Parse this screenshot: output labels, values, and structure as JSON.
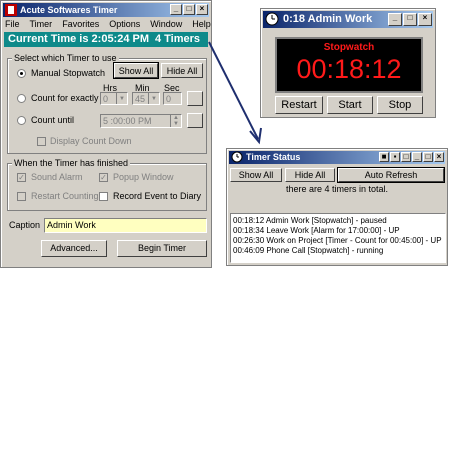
{
  "main": {
    "title": "Acute Softwares Timer",
    "menu": [
      "File",
      "Timer",
      "Favorites",
      "Options",
      "Window",
      "Help"
    ],
    "status_time": "Current Time is 2:05:24 PM",
    "status_count": "4 Timers",
    "select_group_label": "Select which Timer to use",
    "show_all": "Show All",
    "hide_all": "Hide All",
    "manual_stopwatch": "Manual Stopwatch",
    "count_for_exactly": "Count for exactly",
    "hrs_label": "Hrs",
    "min_label": "Min",
    "sec_label": "Sec",
    "hrs_value": "0",
    "min_value": "45",
    "sec_value": "0",
    "count_until": "Count until",
    "until_value": "5 :00:00 PM",
    "display_count_down": "Display Count Down",
    "finished_group_label": "When the Timer has finished",
    "sound_alarm": "Sound Alarm",
    "popup_window": "Popup Window",
    "restart_counting": "Restart Counting",
    "record_event": "Record Event to Diary",
    "caption_label": "Caption",
    "caption_value": "Admin Work",
    "advanced": "Advanced...",
    "begin_timer": "Begin Timer"
  },
  "stopwatch": {
    "title": "0:18 Admin Work",
    "heading": "Stopwatch",
    "time": "00:18:12",
    "restart": "Restart",
    "start": "Start",
    "stop": "Stop"
  },
  "status": {
    "title": "Timer Status",
    "show_all": "Show All",
    "hide_all": "Hide All",
    "auto_refresh": "Auto Refresh",
    "summary": "there are  4 timers in total.",
    "timers": [
      "00:18:12 Admin Work [Stopwatch] - paused",
      "00:18:34 Leave Work [Alarm for 17:00:00] - UP",
      "00:26:30 Work on Project [Timer - Count for 00:45:00] - UP",
      "00:46:09 Phone Call [Stopwatch] - running"
    ]
  },
  "colors": {
    "status_bar": "#0e8a8a",
    "status_text": "#ffffff",
    "lcd_bg": "#000000",
    "lcd_text": "#ff1a1a",
    "caption_bg": "#ffffc0"
  }
}
